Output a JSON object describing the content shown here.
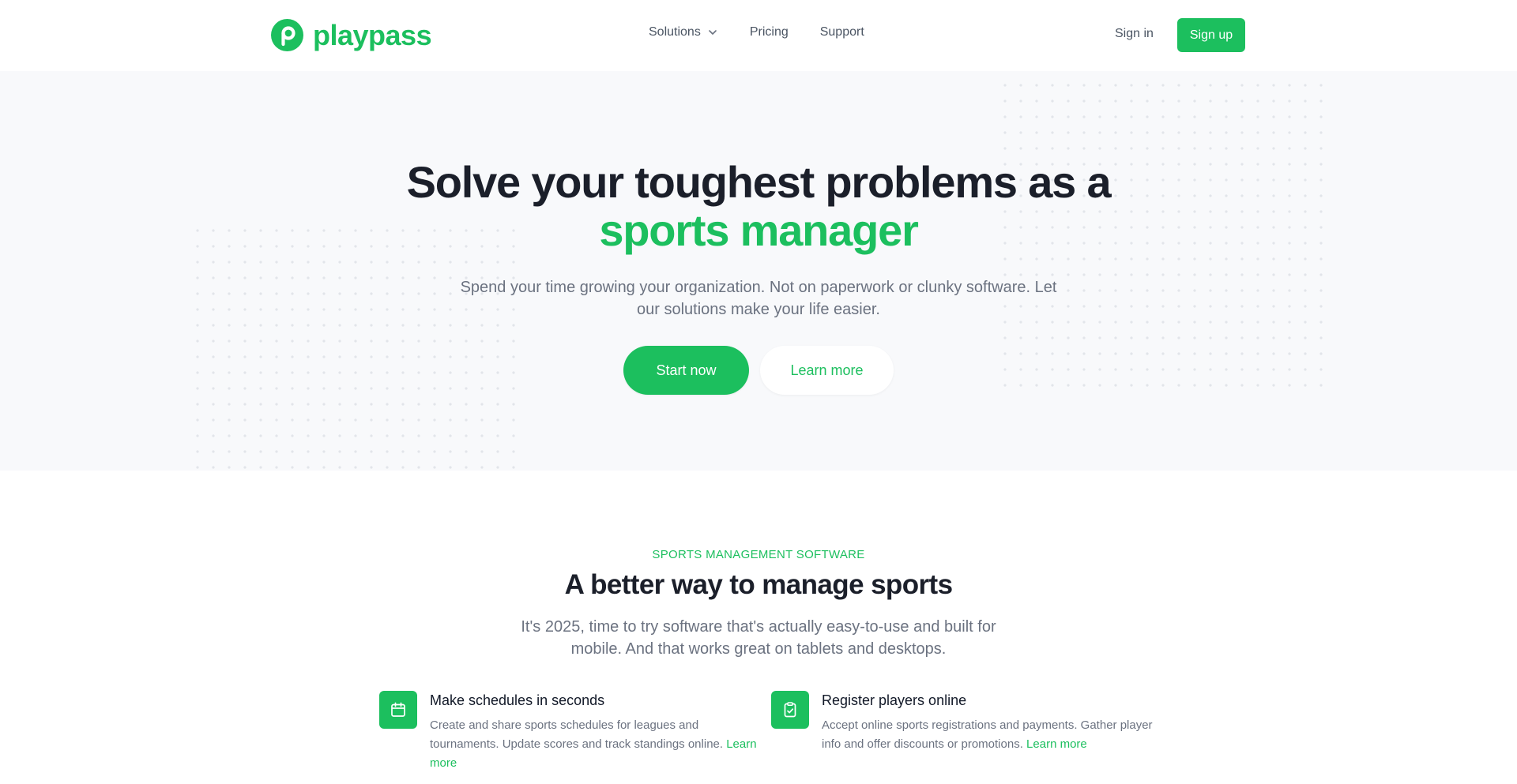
{
  "brand": {
    "name": "playpass",
    "color": "#1cbf5e",
    "logo_icon": "playpass-logo-icon"
  },
  "nav": {
    "items": [
      {
        "label": "Solutions",
        "icon": "chevron-down-icon"
      },
      {
        "label": "Pricing"
      },
      {
        "label": "Support"
      }
    ],
    "signin_label": "Sign in",
    "signup_label": "Sign up"
  },
  "hero": {
    "title_line1": "Solve your toughest problems as a",
    "title_accent": "sports manager",
    "subtitle": "Spend your time growing your organization. Not on paperwork or clunky software. Let our solutions make your life easier.",
    "start_label": "Start now",
    "learn_label": "Learn more"
  },
  "features_section": {
    "eyebrow": "SPORTS MANAGEMENT SOFTWARE",
    "title": "A better way to manage sports",
    "subtitle": "It's 2025, time to try software that's actually easy-to-use and built for mobile. And that works great on tablets and desktops.",
    "items": [
      {
        "icon": "calendar-icon",
        "title": "Make schedules in seconds",
        "text": "Create and share sports schedules for leagues and tournaments. Update scores and track standings online.",
        "link": "Learn more"
      },
      {
        "icon": "clipboard-check-icon",
        "title": "Register players online",
        "text": "Accept online sports registrations and payments. Gather player info and offer discounts or promotions.",
        "link": "Learn more"
      }
    ]
  },
  "colors": {
    "accent": "#1cbf5e",
    "heading": "#1b1f2a",
    "muted": "#6b7280",
    "hero_bg": "#f8f9fb"
  }
}
